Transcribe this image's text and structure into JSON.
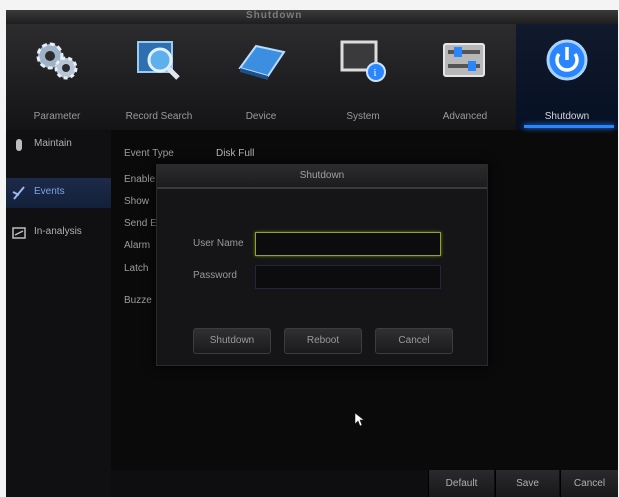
{
  "app": {
    "title": "Shutdown"
  },
  "nav": {
    "items": [
      {
        "label": "Parameter",
        "icon": "gears-icon"
      },
      {
        "label": "Record Search",
        "icon": "magnifier-icon"
      },
      {
        "label": "Device",
        "icon": "hard-drive-icon"
      },
      {
        "label": "System",
        "icon": "monitor-info-icon"
      },
      {
        "label": "Advanced",
        "icon": "sliders-icon"
      },
      {
        "label": "Shutdown",
        "icon": "power-icon"
      }
    ],
    "active": "Shutdown"
  },
  "sidebar": {
    "items": [
      {
        "label": "Maintain",
        "icon": "maintain-icon"
      },
      {
        "label": "Events",
        "icon": "events-icon"
      },
      {
        "label": "In-analysis",
        "icon": "analysis-icon"
      }
    ],
    "active": "Events"
  },
  "content": {
    "event_type_label": "Event Type",
    "event_type_value": "Disk Full",
    "rows": [
      "Enable",
      "Show",
      "Send E",
      "Alarm",
      "Latch",
      "Buzze"
    ]
  },
  "dialog": {
    "title": "Shutdown",
    "username_label": "User Name",
    "password_label": "Password",
    "username_value": "",
    "password_value": "",
    "buttons": {
      "shutdown": "Shutdown",
      "reboot": "Reboot",
      "cancel": "Cancel"
    }
  },
  "bottombar": {
    "default": "Default",
    "save": "Save",
    "cancel": "Cancel"
  },
  "colors": {
    "accent": "#2a86ff",
    "focus": "#8fa52a",
    "background": "#0a0a0b"
  }
}
